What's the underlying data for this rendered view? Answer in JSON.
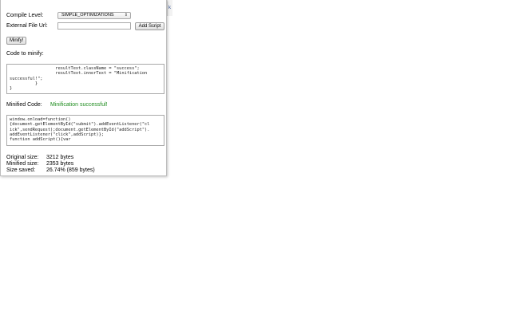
{
  "background": {
    "edge_text": "k"
  },
  "form": {
    "compile_level_label": "Compile Level:",
    "compile_level_value": "SIMPLE_OPTIMIZATIONS",
    "external_url_label": "External File Url:",
    "external_url_value": "",
    "add_script_label": "Add Script",
    "minify_label": "Minify!"
  },
  "input_section": {
    "heading": "Code to minify:",
    "code": "                  resultText.className = \"success\";\n                  resultText.innerText = \"Minification\nsuccessful!\";\n          }\n}"
  },
  "output_section": {
    "label": "Minified Code:",
    "status": "Minification successful!",
    "status_color": "#1e8c1e",
    "code": "window.onload=function()\n{document.getElementById(\"submit\").addEventListener(\"cl\nick\",sendRequest);document.getElementById(\"addScript\").\naddEventListener(\"click\",addScript)};\nfunction addScript(){var"
  },
  "stats": {
    "original_label": "Original size:",
    "original_value": "3212 bytes",
    "minified_label": "Minified size:",
    "minified_value": "2353 bytes",
    "saved_label": "Size saved:",
    "saved_value": "26.74% (859 bytes)"
  }
}
